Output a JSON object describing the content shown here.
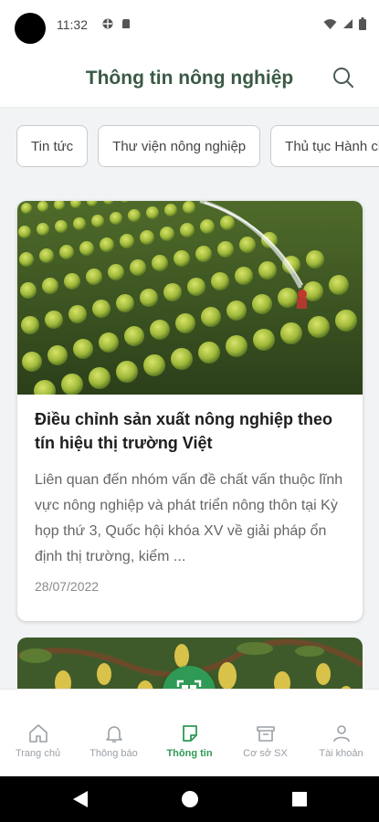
{
  "status_bar": {
    "time": "11:32"
  },
  "header": {
    "title": "Thông tin nông nghiệp",
    "search_icon": "search-icon"
  },
  "chips": [
    {
      "label": "Tin tức"
    },
    {
      "label": "Thư viện nông nghiệp"
    },
    {
      "label": "Thủ tục Hành chính"
    }
  ],
  "articles": [
    {
      "title": "Điều chỉnh sản xuất nông nghiệp theo tín hiệu thị trường Việt",
      "excerpt": "Liên quan đến nhóm vấn đề chất vấn thuộc lĩnh vực nông nghiệp và phát triển nông thôn tại Kỳ họp thứ 3, Quốc hội khóa XV về giải pháp ổn định thị trường, kiểm ...",
      "date": "28/07/2022"
    }
  ],
  "bottom_nav": {
    "items": [
      {
        "label": "Trang chủ",
        "icon": "home-icon"
      },
      {
        "label": "Thông báo",
        "icon": "bell-icon"
      },
      {
        "label": "Thông tin",
        "icon": "note-icon",
        "active": true
      },
      {
        "label": "Cơ sở SX",
        "icon": "store-icon"
      },
      {
        "label": "Tài khoản",
        "icon": "user-icon"
      }
    ]
  },
  "colors": {
    "accent": "#2e9a55",
    "title": "#3a5a45",
    "background": "#f2f3f4"
  }
}
